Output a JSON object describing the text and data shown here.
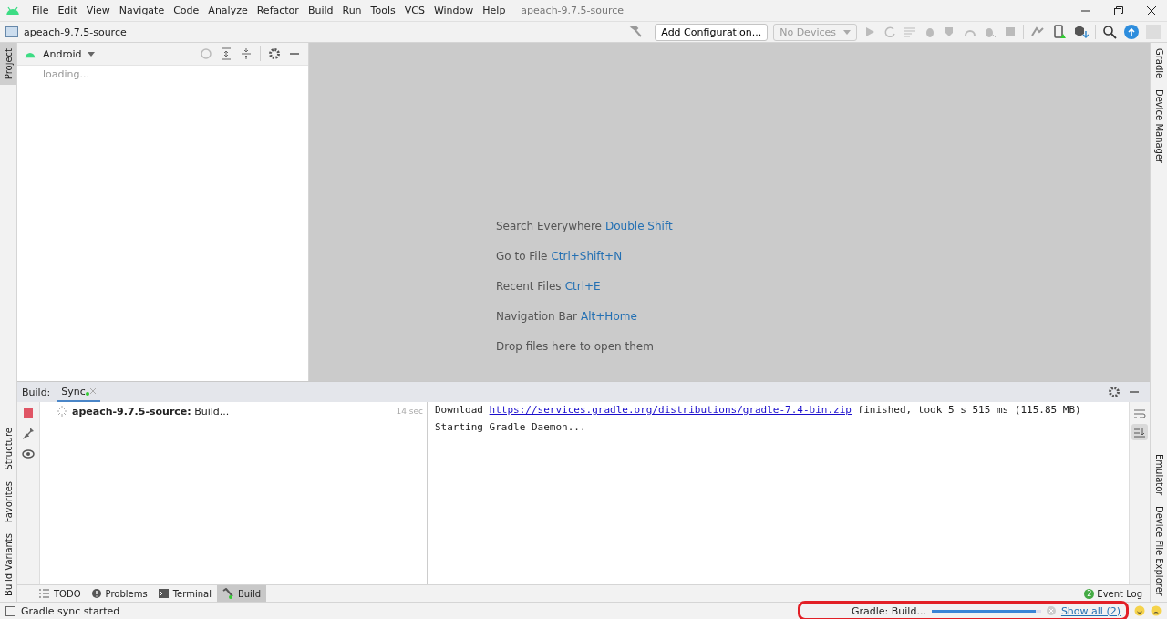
{
  "menu": [
    "File",
    "Edit",
    "View",
    "Navigate",
    "Code",
    "Analyze",
    "Refactor",
    "Build",
    "Run",
    "Tools",
    "VCS",
    "Window",
    "Help"
  ],
  "window": {
    "title": "apeach-9.7.5-source"
  },
  "navbar": {
    "project": "apeach-9.7.5-source",
    "add_configuration": "Add Configuration...",
    "devices": "No Devices"
  },
  "left_stripe": {
    "top": [
      {
        "label": "Project",
        "selected": true
      }
    ],
    "bottom": [
      {
        "label": "Structure",
        "selected": false
      },
      {
        "label": "Favorites",
        "selected": false
      },
      {
        "label": "Build Variants",
        "selected": false
      }
    ]
  },
  "right_stripe": {
    "top": [
      {
        "label": "Gradle",
        "selected": false
      },
      {
        "label": "Device Manager",
        "selected": false
      }
    ],
    "bottom": [
      {
        "label": "Emulator",
        "selected": false
      },
      {
        "label": "Device File Explorer",
        "selected": false
      }
    ]
  },
  "project_panel": {
    "view": "Android",
    "status": "loading..."
  },
  "welcome": [
    {
      "text": "Search Everywhere",
      "shortcut": "Double Shift"
    },
    {
      "text": "Go to File",
      "shortcut": "Ctrl+Shift+N"
    },
    {
      "text": "Recent Files",
      "shortcut": "Ctrl+E"
    },
    {
      "text": "Navigation Bar",
      "shortcut": "Alt+Home"
    },
    {
      "text": "Drop files here to open them"
    }
  ],
  "build_panel": {
    "label": "Build:",
    "tabs": [
      {
        "label": "Sync",
        "selected": true
      }
    ],
    "tree": [
      {
        "text": "**apeach-9.7.5-source:** Build...",
        "time": "14 sec"
      }
    ],
    "console": [
      {
        "before": "Download ",
        "link": "https://services.gradle.org/distributions/gradle-7.4-bin.zip",
        "after": " finished, took 5 s 515 ms (115.85 MB)"
      },
      {
        "before": "Starting Gradle Daemon..."
      }
    ]
  },
  "bottom_tabs": [
    {
      "label": "TODO",
      "selected": false
    },
    {
      "label": "Problems",
      "selected": false
    },
    {
      "label": "Terminal",
      "selected": false
    },
    {
      "label": "Build",
      "selected": true
    }
  ],
  "event_log": {
    "label": "Event Log",
    "count": "2"
  },
  "status_bar": {
    "message": "Gradle sync started",
    "task": "Gradle: Build...",
    "level": 0.95,
    "show_all": "Show all (2)"
  }
}
